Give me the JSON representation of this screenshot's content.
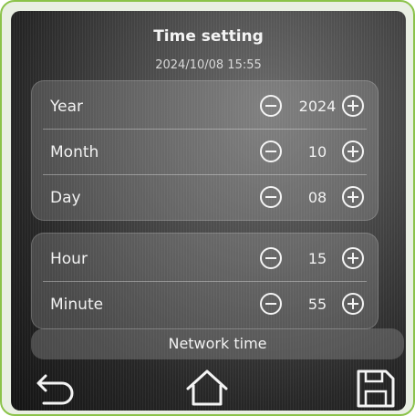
{
  "header": {
    "title": "Time setting",
    "datetime": "2024/10/08 15:55"
  },
  "date_group": [
    {
      "label": "Year",
      "value": "2024"
    },
    {
      "label": "Month",
      "value": "10"
    },
    {
      "label": "Day",
      "value": "08"
    }
  ],
  "time_group": [
    {
      "label": "Hour",
      "value": "15"
    },
    {
      "label": "Minute",
      "value": "55"
    }
  ],
  "network_button": {
    "label": "Network time"
  },
  "nav": {
    "back_icon": "back-arrow-icon",
    "home_icon": "home-icon",
    "save_icon": "save-disk-icon"
  },
  "colors": {
    "bezel": "#8bc34a",
    "text": "#f2f2f2"
  }
}
